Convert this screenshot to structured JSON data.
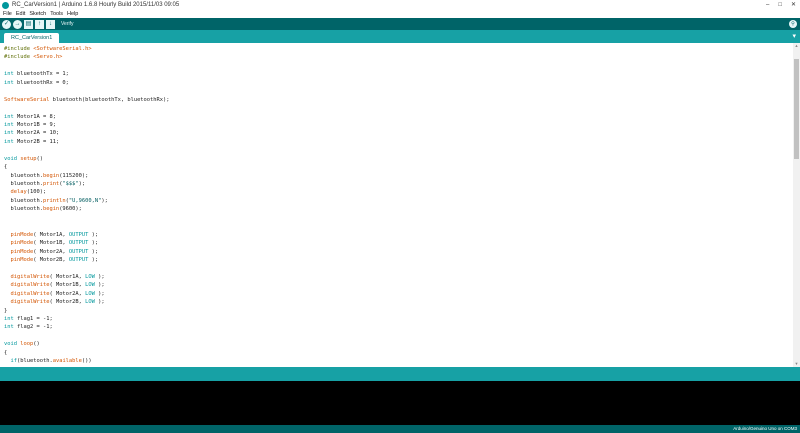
{
  "window": {
    "title": "RC_CarVersion1 | Arduino 1.6.8 Hourly Build 2015/11/03 09:05",
    "controls": [
      "–",
      "□",
      "✕"
    ]
  },
  "menus": [
    "File",
    "Edit",
    "Sketch",
    "Tools",
    "Help"
  ],
  "toolbar": {
    "verify_icon": "✓",
    "upload_icon": "→",
    "new_icon": "▤",
    "open_icon": "↑",
    "save_icon": "↓",
    "hint": "Verify",
    "serial_monitor_icon": "⚲"
  },
  "tabs": [
    {
      "label": "RC_CarVersion1"
    }
  ],
  "tab_menu_icon": "▾",
  "code_lines": [
    "#include <SoftwareSerial.h>",
    "#include <Servo.h>",
    "",
    "int bluetoothTx = 1;",
    "int bluetoothRx = 0;",
    "",
    "SoftwareSerial bluetooth(bluetoothTx, bluetoothRx);",
    "",
    "int Motor1A = 8;",
    "int Motor1B = 9;",
    "int Motor2A = 10;",
    "int Motor2B = 11;",
    "",
    "void setup()",
    "{",
    "  bluetooth.begin(115200);",
    "  bluetooth.print(\"$$$\");",
    "  delay(100);",
    "  bluetooth.println(\"U,9600,N\");",
    "  bluetooth.begin(9600);",
    "",
    "",
    "  pinMode( Motor1A, OUTPUT );",
    "  pinMode( Motor1B, OUTPUT );",
    "  pinMode( Motor2A, OUTPUT );",
    "  pinMode( Motor2B, OUTPUT );",
    "",
    "  digitalWrite( Motor1A, LOW );",
    "  digitalWrite( Motor1B, LOW );",
    "  digitalWrite( Motor2A, LOW );",
    "  digitalWrite( Motor2B, LOW );",
    "}",
    "int flag1 = -1;",
    "int flag2 = -1;",
    "",
    "void loop()",
    "{",
    "  if(bluetooth.available())",
    "  {"
  ],
  "status_bar": {
    "board": "Arduino/Genuino Uno on COM3"
  },
  "colors": {
    "toolbar": "#006468",
    "tabbar": "#17a1a5",
    "keyword": "#00979c",
    "function": "#d35400",
    "console": "#000000"
  }
}
